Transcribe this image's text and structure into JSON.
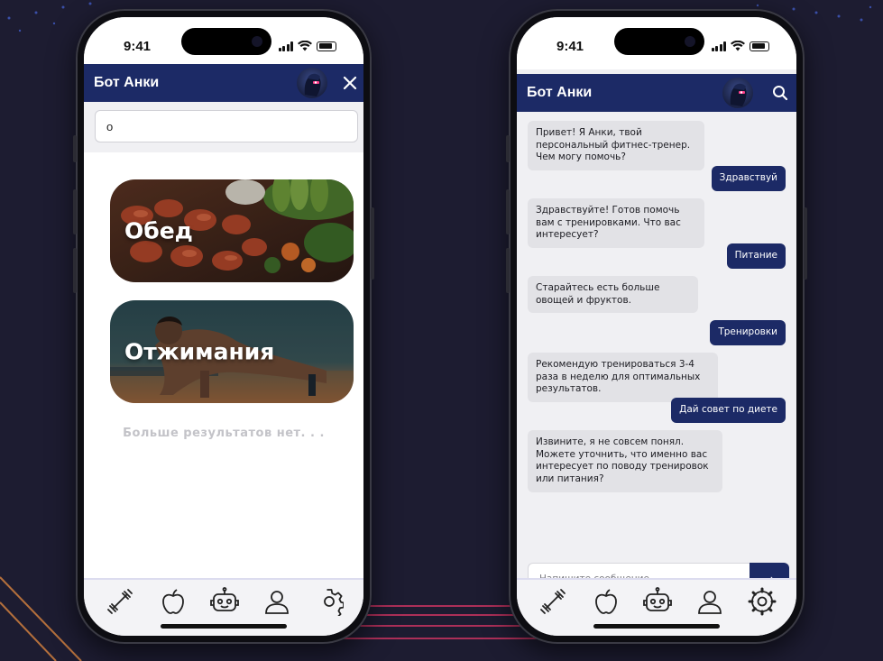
{
  "theme": {
    "background": "#1d1c31",
    "header": "#1c2a66",
    "user_bubble": "#1c2a66",
    "bot_bubble": "#e2e2e6",
    "accent_line": "#e0356a"
  },
  "status_bar": {
    "time": "9:41"
  },
  "left_screen": {
    "header_title": "Бот Анки",
    "header_action_icon": "close-icon",
    "search_value": "о",
    "results": [
      {
        "label": "Обед",
        "image": "food-photo"
      },
      {
        "label": "Отжимания",
        "image": "pushup-photo"
      }
    ],
    "no_more_text": "Больше результатов нет. . ."
  },
  "right_screen": {
    "header_title": "Бот Анки",
    "header_action_icon": "search-icon",
    "messages": [
      {
        "from": "bot",
        "text": "Привет! Я Анки, твой персональный фитнес-тренер. Чем могу помочь?"
      },
      {
        "from": "user",
        "text": "Здравствуй"
      },
      {
        "from": "bot",
        "text": "Здравствуйте! Готов помочь вам с тренировками. Что вас интересует?"
      },
      {
        "from": "user",
        "text": "Питание"
      },
      {
        "from": "bot",
        "text": "Старайтесь есть больше овощей и фруктов."
      },
      {
        "from": "user",
        "text": "Тренировки"
      },
      {
        "from": "bot",
        "text": "Рекомендую тренироваться 3-4 раза в неделю для оптимальных результатов."
      },
      {
        "from": "user",
        "text": "Дай совет по диете"
      },
      {
        "from": "bot",
        "text": "Извините, я не совсем понял. Можете уточнить, что именно вас интересует по поводу тренировок или питания?"
      }
    ],
    "composer_placeholder": "Напишите сообщение...",
    "send_label": "→"
  },
  "tabbar": {
    "items": [
      {
        "icon": "dumbbell-icon"
      },
      {
        "icon": "apple-icon"
      },
      {
        "icon": "robot-icon"
      },
      {
        "icon": "user-icon"
      },
      {
        "icon": "gear-icon"
      }
    ]
  }
}
